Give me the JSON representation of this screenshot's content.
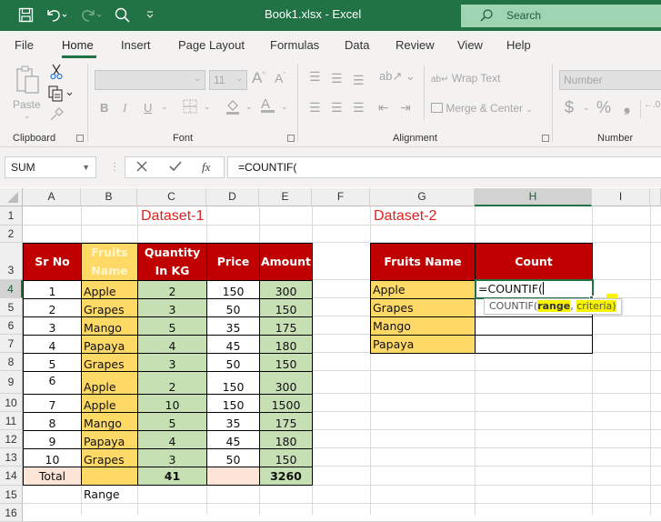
{
  "titlebar": {
    "title": "Book1.xlsx  -  Excel",
    "search_placeholder": "Search",
    "icons": [
      "save-icon",
      "undo-icon",
      "redo-icon",
      "search-icon",
      "customize-qat-icon"
    ]
  },
  "menu": {
    "tabs": [
      "File",
      "Home",
      "Insert",
      "Page Layout",
      "Formulas",
      "Data",
      "Review",
      "View",
      "Help"
    ],
    "active": "Home"
  },
  "ribbon": {
    "groups": {
      "clipboard": "Clipboard",
      "font": "Font",
      "alignment": "Alignment",
      "number": "Number"
    },
    "paste_label": "Paste",
    "font_size": "11",
    "wrap_text": "Wrap Text",
    "merge_center": "Merge & Center",
    "number_format": "Number",
    "bold": "B",
    "italic": "I",
    "underline": "U",
    "currency": "$",
    "percent": "%",
    "comma": "9"
  },
  "formula_bar": {
    "name_box": "SUM",
    "formula": "=COUNTIF(",
    "fx": "fx"
  },
  "columns": [
    "A",
    "B",
    "C",
    "D",
    "E",
    "F",
    "G",
    "H",
    "I"
  ],
  "selected_column": "H",
  "rows": [
    "1",
    "2",
    "3",
    "4",
    "5",
    "6",
    "7",
    "8",
    "9",
    "10",
    "11",
    "12",
    "13",
    "14",
    "15",
    "16"
  ],
  "selected_row": "4",
  "dataset1": {
    "title": "Dataset-1",
    "headers": [
      "Sr No",
      "Fruits Name",
      "Quantity In KG",
      "Price",
      "Amount"
    ],
    "rows": [
      [
        "1",
        "Apple",
        "2",
        "150",
        "300"
      ],
      [
        "2",
        "Grapes",
        "3",
        "50",
        "150"
      ],
      [
        "3",
        "Mango",
        "5",
        "35",
        "175"
      ],
      [
        "4",
        "Papaya",
        "4",
        "45",
        "180"
      ],
      [
        "5",
        "Grapes",
        "3",
        "50",
        "150"
      ],
      [
        "6",
        "Apple",
        "2",
        "150",
        "300"
      ],
      [
        "7",
        "Apple",
        "10",
        "150",
        "1500"
      ],
      [
        "8",
        "Mango",
        "5",
        "35",
        "175"
      ],
      [
        "9",
        "Papaya",
        "4",
        "45",
        "180"
      ],
      [
        "10",
        "Grapes",
        "3",
        "50",
        "150"
      ]
    ],
    "total_label": "Total",
    "total_qty": "41",
    "total_amount": "3260",
    "note": "Range"
  },
  "dataset2": {
    "title": "Dataset-2",
    "headers": [
      "Fruits Name",
      "Count"
    ],
    "fruits": [
      "Apple",
      "Grapes",
      "Mango",
      "Papaya"
    ],
    "active_cell_value": "=COUNTIF("
  },
  "tooltip": {
    "func": "COUNTIF(",
    "arg1": "range",
    "sep": ", ",
    "arg2": "criteria",
    "close": ")"
  },
  "colors": {
    "excel_green": "#217346",
    "header_red": "#c00000",
    "fruit_yellow": "#ffd966",
    "value_green": "#c6e0b4",
    "total_pink": "#fce4d6",
    "title_red": "#e02020",
    "highlight": "#f8f400"
  }
}
